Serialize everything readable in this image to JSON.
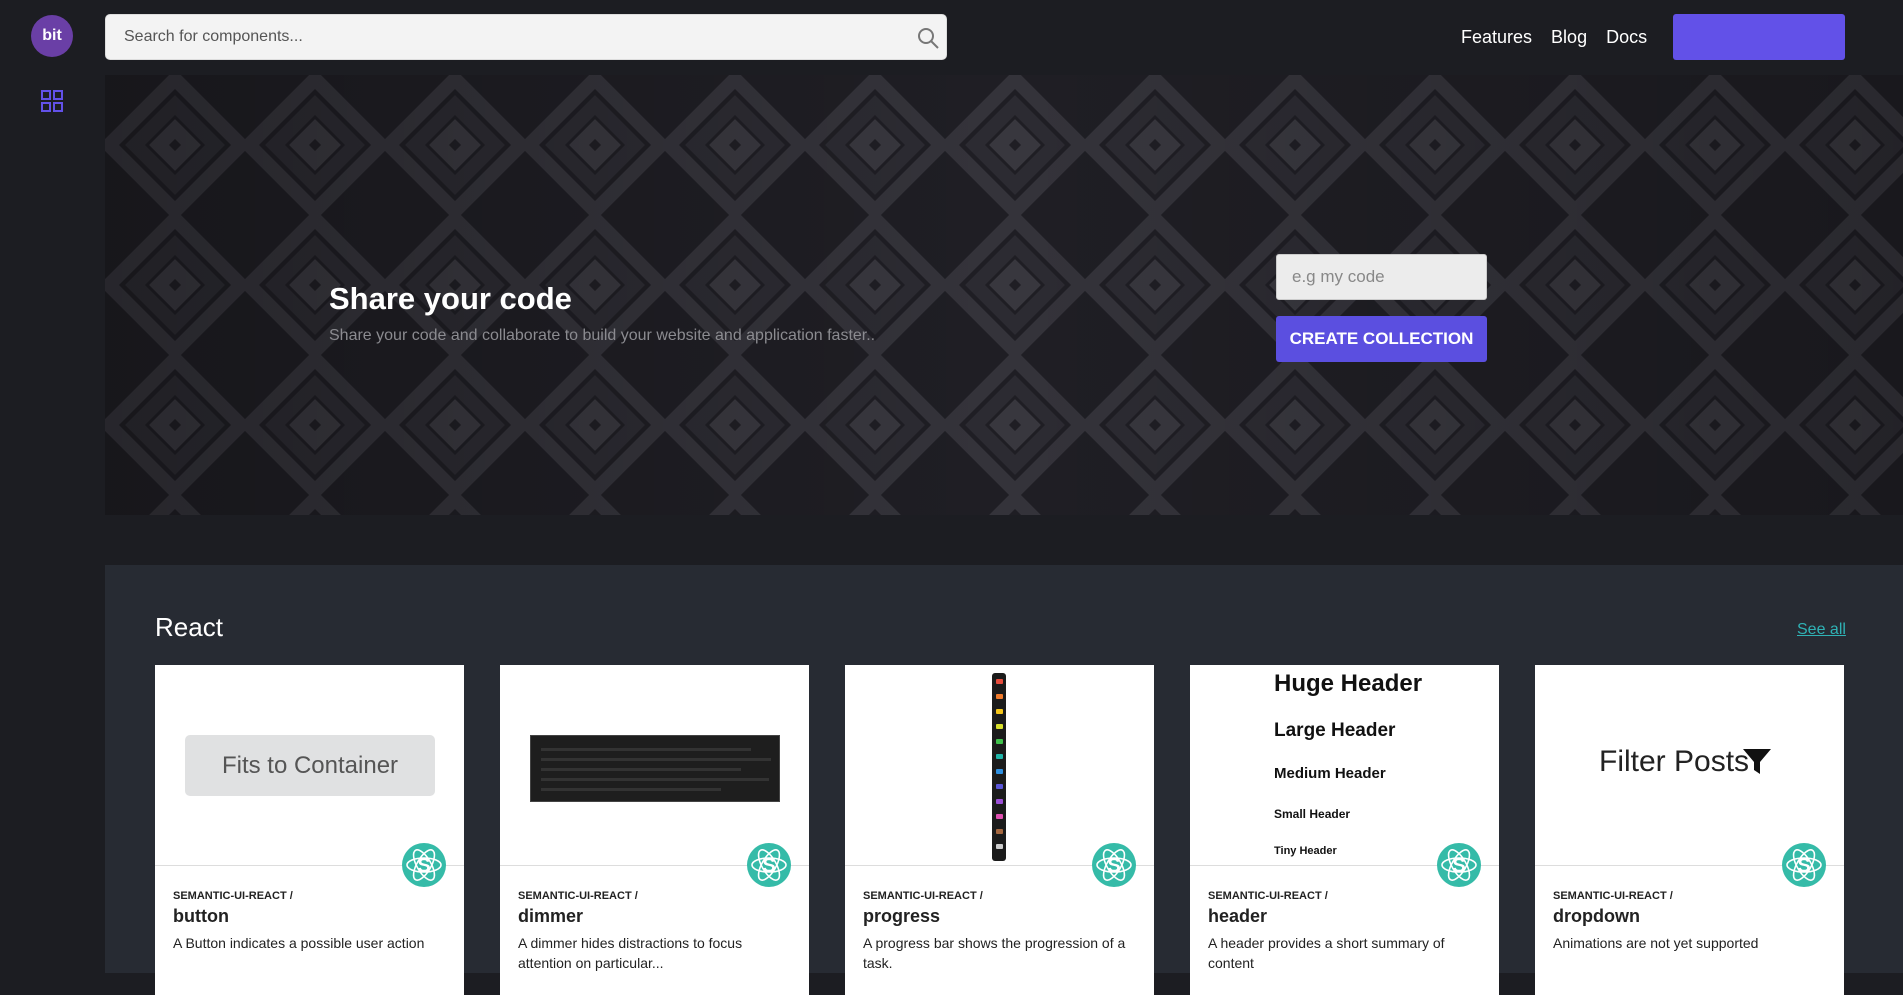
{
  "brand": {
    "logo_text": "bit"
  },
  "search": {
    "placeholder": "Search for components..."
  },
  "nav": {
    "features": "Features",
    "blog": "Blog",
    "docs": "Docs",
    "cta_label": ""
  },
  "hero": {
    "title": "Share your code",
    "subtitle": "Share your code and collaborate to build your website and application faster..",
    "input_placeholder": "e.g my code",
    "button_label": "CREATE COLLECTION"
  },
  "section": {
    "title": "React",
    "see_all": "See all",
    "cards": [
      {
        "scope": "SEMANTIC-UI-REACT /",
        "name": "button",
        "description": "A Button indicates a possible user action",
        "preview_label": "Fits to Container"
      },
      {
        "scope": "SEMANTIC-UI-REACT /",
        "name": "dimmer",
        "description": "A dimmer hides distractions to focus attention on particular..."
      },
      {
        "scope": "SEMANTIC-UI-REACT /",
        "name": "progress",
        "description": "A progress bar shows the progression of a task."
      },
      {
        "scope": "SEMANTIC-UI-REACT /",
        "name": "header",
        "description": "A header provides a short summary of content",
        "preview_headers": [
          "Huge Header",
          "Large Header",
          "Medium Header",
          "Small Header",
          "Tiny Header"
        ]
      },
      {
        "scope": "SEMANTIC-UI-REACT /",
        "name": "dropdown",
        "description": "Animations are not yet supported",
        "preview_label": "Filter Posts"
      }
    ]
  },
  "colors": {
    "accent": "#6251e8",
    "link": "#2fb2b5",
    "badge": "#35bba8"
  },
  "icons": [
    "grid-icon",
    "search-icon",
    "semantic-ui-icon",
    "filter-icon"
  ]
}
